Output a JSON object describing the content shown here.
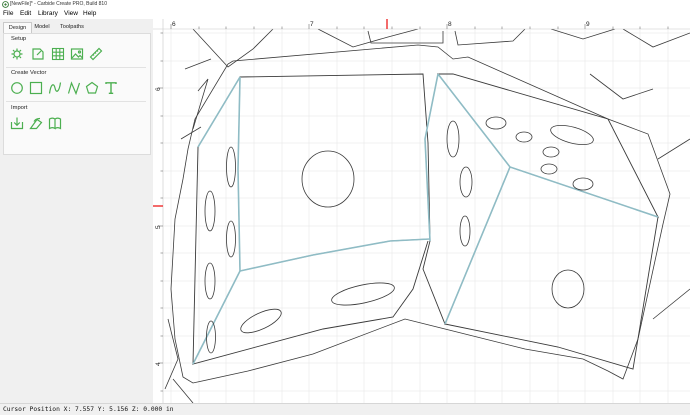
{
  "window": {
    "title": "[NewFile]* - Carbide Create PRO, Build 810"
  },
  "menu": [
    "File",
    "Edit",
    "Library",
    "View",
    "Help"
  ],
  "tabs": [
    "Design",
    "Model",
    "Toolpaths"
  ],
  "sections": {
    "setup": "Setup",
    "create_vector": "Create Vector",
    "import": "Import"
  },
  "tools": {
    "setup": [
      "job-setup-icon",
      "new-page-icon",
      "grid-icon",
      "image-icon",
      "measure-icon"
    ],
    "create_vector": [
      "circle-tool-icon",
      "rectangle-tool-icon",
      "curve-tool-icon",
      "polygon-tool-icon",
      "text-tool-icon"
    ],
    "import": [
      "import-icon",
      "import-vector-icon",
      "library-icon"
    ]
  },
  "ruler": {
    "x_labels": [
      "6",
      "7",
      "8",
      "9"
    ],
    "y_labels": [
      "6",
      "5",
      "4"
    ]
  },
  "status": {
    "text": "Cursor Position X: 7.557 Y: 5.156 Z: 0.000 in"
  },
  "colors": {
    "accent_green": "#4caf50",
    "cursor_marker": "#ee2b2b",
    "selected_path": "#8fbcc5"
  }
}
